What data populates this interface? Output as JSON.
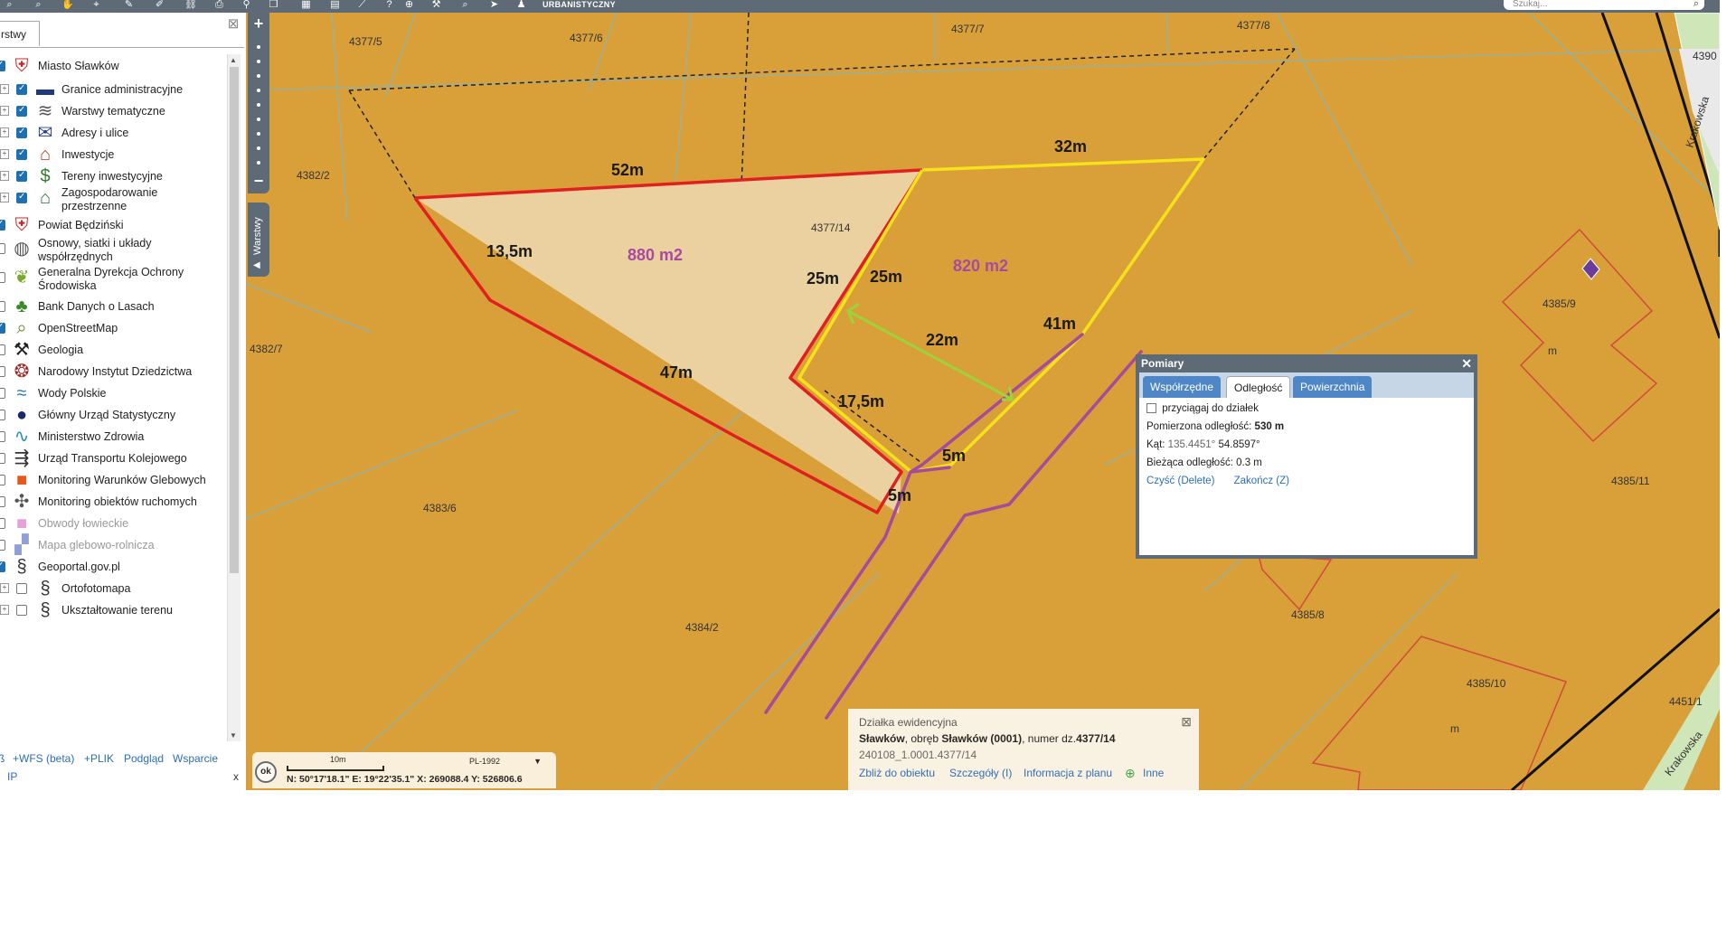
{
  "toolbar": {
    "title": "URBANISTYCZNY",
    "search_placeholder": "Szukaj..."
  },
  "layers_panel": {
    "tab_label": "rstwy",
    "items": [
      {
        "label": "Miasto Sławków",
        "checked": true,
        "expander": false,
        "icon": "coat-of-arms-icon",
        "grey": false
      },
      {
        "label": "Granice administracyjne",
        "checked": true,
        "expander": true,
        "icon": "boundary-line-icon",
        "grey": false
      },
      {
        "label": "Warstwy tematyczne",
        "checked": true,
        "expander": true,
        "icon": "layers-stack-icon",
        "grey": false
      },
      {
        "label": "Adresy i ulice",
        "checked": true,
        "expander": true,
        "icon": "envelope-icon",
        "grey": false
      },
      {
        "label": "Inwestycje",
        "checked": true,
        "expander": true,
        "icon": "buildings-icon",
        "grey": false
      },
      {
        "label": "Tereny inwestycyjne",
        "checked": true,
        "expander": true,
        "icon": "dollar-icon",
        "grey": false
      },
      {
        "label": "Zagospodarowanie",
        "label2": "przestrzenne",
        "checked": true,
        "expander": true,
        "icon": "city-plan-icon",
        "grey": false
      },
      {
        "label": "Powiat Będziński",
        "checked": true,
        "expander": false,
        "icon": "coat-of-arms-icon",
        "grey": false
      },
      {
        "label": "Osnowy, siatki i układy",
        "label2": "współrzędnych",
        "checked": false,
        "expander": false,
        "icon": "globe-grid-icon",
        "grey": false
      },
      {
        "label": "Generalna Dyrekcja Ochrony",
        "label2": "Środowiska",
        "checked": false,
        "expander": false,
        "icon": "leaf-icon",
        "grey": false
      },
      {
        "label": "Bank Danych o Lasach",
        "checked": false,
        "expander": false,
        "icon": "tree-icon",
        "grey": false
      },
      {
        "label": "OpenStreetMap",
        "checked": true,
        "expander": false,
        "icon": "map-magnifier-icon",
        "grey": false
      },
      {
        "label": "Geologia",
        "checked": false,
        "expander": false,
        "icon": "pickaxe-icon",
        "grey": false
      },
      {
        "label": "Narodowy Instytut Dziedzictwa",
        "checked": false,
        "expander": false,
        "icon": "heritage-icon",
        "grey": false
      },
      {
        "label": "Wody Polskie",
        "checked": false,
        "expander": false,
        "icon": "water-waves-icon",
        "grey": false
      },
      {
        "label": "Główny Urząd Statystyczny",
        "checked": false,
        "expander": false,
        "icon": "statistics-drop-icon",
        "grey": false
      },
      {
        "label": "Ministerstwo Zdrowia",
        "checked": false,
        "expander": false,
        "icon": "pulse-line-icon",
        "grey": false
      },
      {
        "label": "Urząd Transportu Kolejowego",
        "checked": false,
        "expander": false,
        "icon": "railway-icon",
        "grey": false
      },
      {
        "label": "Monitoring Warunków Glebowych",
        "checked": false,
        "expander": false,
        "icon": "gradient-square-icon",
        "grey": false
      },
      {
        "label": "Monitoring obiektów ruchomych",
        "checked": false,
        "expander": false,
        "icon": "satellite-icon",
        "grey": false
      },
      {
        "label": "Obwody łowieckie",
        "checked": false,
        "expander": false,
        "icon": "pink-square-icon",
        "grey": true
      },
      {
        "label": "Mapa glebowo-rolnicza",
        "checked": false,
        "expander": false,
        "icon": "soil-map-icon",
        "grey": true
      },
      {
        "label": "Geoportal.gov.pl",
        "checked": true,
        "expander": false,
        "icon": "geoportal-icon",
        "grey": false
      },
      {
        "label": "Ortofotomapa",
        "checked": false,
        "expander": true,
        "icon": "geoportal-icon",
        "grey": false
      },
      {
        "label": "Ukształtowanie terenu",
        "checked": false,
        "expander": true,
        "icon": "geoportal-icon",
        "grey": false
      }
    ],
    "footer": {
      "wfs": "+WFS (beta)",
      "plik": "+PLIK",
      "podglad": "Podgląd",
      "wsparcie": "Wsparcie",
      "ip": "IP",
      "close": "x"
    }
  },
  "map": {
    "parcel_labels": [
      "4377/5",
      "4377/6",
      "4377/7",
      "4377/8",
      "4382/2",
      "4382/7",
      "4377/14",
      "4383/6",
      "4384/2",
      "4385/9",
      "4385/11",
      "4385/8",
      "4385/10",
      "4451/1",
      "4390",
      "m",
      "m",
      "Krakowska",
      "Krakowska"
    ],
    "measurements": [
      "52m",
      "32m",
      "13,5m",
      "25m",
      "25m",
      "22m",
      "41m",
      "47m",
      "17,5m",
      "5m",
      "5m"
    ],
    "areas": [
      "880 m2",
      "820 m2"
    ],
    "colors": {
      "background": "#d9a03a",
      "plot_fill": "#ecd1a0",
      "red_line": "#e02020",
      "yellow_line": "#f5e21a",
      "purple_line": "#a64a9a",
      "green_arrow": "#9fd23a"
    }
  },
  "pomiary": {
    "title": "Pomiary",
    "tabs": [
      "Współrzędne",
      "Odległość",
      "Powierzchnia"
    ],
    "active_tab": "Odległość",
    "snap_label": "przyciągaj do działek",
    "distance_label": "Pomierzona odległość:",
    "distance_value": "530 m",
    "angle_label": "Kąt:",
    "angle_value_a": "135.4451°",
    "angle_value_b": "54.8597°",
    "current_label": "Bieżąca odległość:",
    "current_value": "0.3 m",
    "clear_link": "Czyść (Delete)",
    "finish_link": "Zakończ (Z)"
  },
  "info_popup": {
    "title": "Działka ewidencyjna",
    "line_a": "Sławków",
    "line_b": ", obręb ",
    "line_c": "Sławków (0001)",
    "line_d": ", numer dz.",
    "line_e": "4377/14",
    "id": "240108_1.0001.4377/14",
    "actions": [
      "Zbliż do obiektu",
      "Szczegóły (I)",
      "Informacja z planu",
      "Inne"
    ]
  },
  "coords_bar": {
    "ok": "ok",
    "scale": "10m",
    "crs": "PL-1992",
    "coords": "N: 50°17'18.1\"  E: 19°22'35.1\"   X: 269088.4   Y: 526806.6"
  }
}
